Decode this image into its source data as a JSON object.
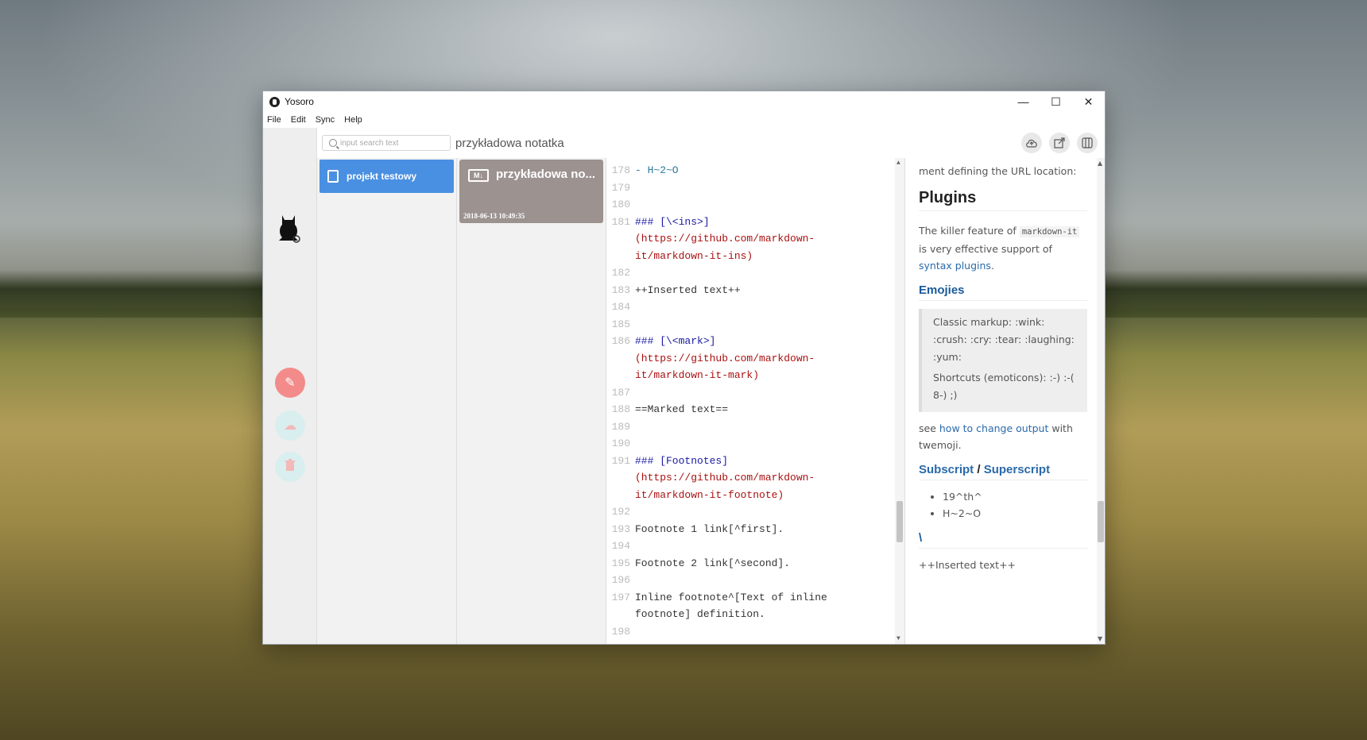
{
  "window": {
    "title": "Yosoro",
    "min": "—",
    "max": "☐",
    "close": "✕"
  },
  "menu": [
    "File",
    "Edit",
    "Sync",
    "Help"
  ],
  "search": {
    "placeholder": "input search text"
  },
  "current_note_title": "przykładowa notatka",
  "toolbar_icons": [
    "cloud-upload-icon",
    "export-icon",
    "split-view-icon"
  ],
  "sidebar": {
    "edit_icon": "✎",
    "cloud_icon": "☁",
    "trash_icon": "🗑"
  },
  "project": {
    "name": "projekt testowy"
  },
  "note": {
    "badge": "M↓",
    "name": "przykładowa no...",
    "date": "2018-06-13 10:49:35"
  },
  "editor_lines": [
    {
      "n": "178",
      "t": "- H~2~O"
    },
    {
      "n": "179",
      "t": ""
    },
    {
      "n": "180",
      "t": ""
    },
    {
      "n": "181",
      "t": "### [\\<ins>]"
    },
    {
      "n": "",
      "t": "(https://github.com/markdown-"
    },
    {
      "n": "",
      "t": "it/markdown-it-ins)"
    },
    {
      "n": "182",
      "t": ""
    },
    {
      "n": "183",
      "t": "++Inserted text++"
    },
    {
      "n": "184",
      "t": ""
    },
    {
      "n": "185",
      "t": ""
    },
    {
      "n": "186",
      "t": "### [\\<mark>]"
    },
    {
      "n": "",
      "t": "(https://github.com/markdown-"
    },
    {
      "n": "",
      "t": "it/markdown-it-mark)"
    },
    {
      "n": "187",
      "t": ""
    },
    {
      "n": "188",
      "t": "==Marked text=="
    },
    {
      "n": "189",
      "t": ""
    },
    {
      "n": "190",
      "t": ""
    },
    {
      "n": "191",
      "t": "### [Footnotes]"
    },
    {
      "n": "",
      "t": "(https://github.com/markdown-"
    },
    {
      "n": "",
      "t": "it/markdown-it-footnote)"
    },
    {
      "n": "192",
      "t": ""
    },
    {
      "n": "193",
      "t": "Footnote 1 link[^first]."
    },
    {
      "n": "194",
      "t": ""
    },
    {
      "n": "195",
      "t": "Footnote 2 link[^second]."
    },
    {
      "n": "196",
      "t": ""
    },
    {
      "n": "197",
      "t": "Inline footnote^[Text of inline "
    },
    {
      "n": "",
      "t": "footnote] definition."
    },
    {
      "n": "198",
      "t": ""
    }
  ],
  "preview": {
    "top_fragment": "ment defining the URL location:",
    "plugins_heading": "Plugins",
    "plugins_text_1": "The killer feature of ",
    "plugins_code": "markdown-it",
    "plugins_text_2": " is very effective support of ",
    "plugins_link": "syntax plugins",
    "plugins_text_3": ".",
    "emojis_heading": "Emojies",
    "quote_1": "Classic markup: :wink: :crush: :cry: :tear: :laughing: :yum:",
    "quote_2": "Shortcuts (emoticons): :-) :-( 8-) ;)",
    "see_text": "see ",
    "see_link": "how to change output",
    "see_text_2": " with twemoji.",
    "subsup_heading_a": "Subscript",
    "subsup_sep": " / ",
    "subsup_heading_b": "Superscript",
    "list": [
      "19^th^",
      "H~2~O"
    ],
    "ins_heading": "\\",
    "inserted_text": "++Inserted text++"
  }
}
